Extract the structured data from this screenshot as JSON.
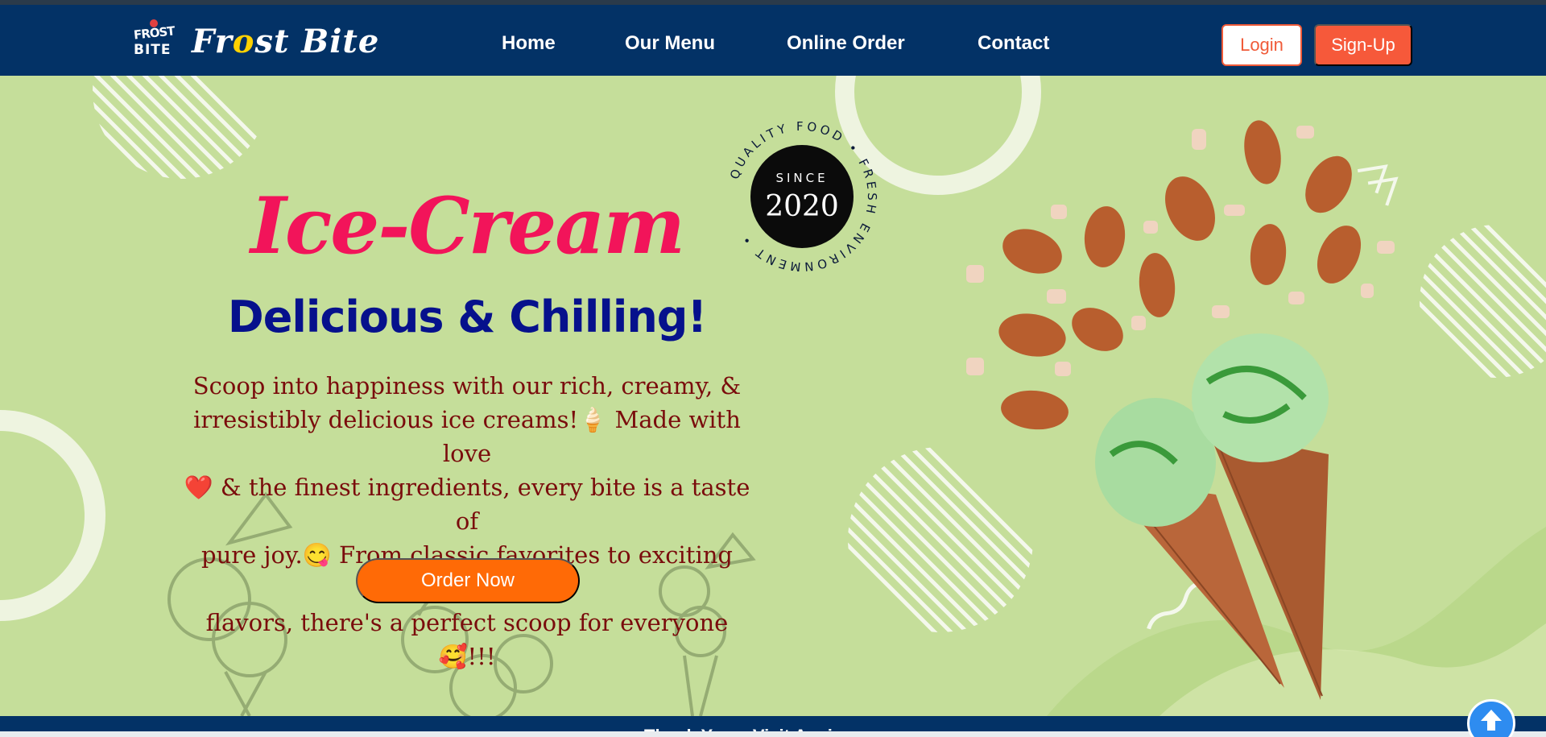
{
  "brand": {
    "badge_line1": "FROST",
    "badge_line2": "BITE",
    "name_part1": "Fr",
    "name_o": "o",
    "name_part2": "st Bite"
  },
  "nav": {
    "links": [
      "Home",
      "Our Menu",
      "Online Order",
      "Contact"
    ],
    "login_label": "Login",
    "signup_label": "Sign-Up"
  },
  "hero": {
    "title": "Ice-Cream",
    "subtitle": "Delicious & Chilling!",
    "description_lines": [
      "Scoop into happiness with our rich, creamy, &",
      "irresistibly delicious ice creams!🍦 Made with love",
      "❤️ & the finest ingredients, every bite is a taste of",
      "pure joy.😋 From classic favorites to exciting new",
      "flavors, there's a perfect scoop for everyone🥰!!!"
    ],
    "order_button": "Order Now"
  },
  "stamp": {
    "ring_text": "QUALITY FOOD • FRESH ENVIRONMENT •",
    "since": "SINCE",
    "year": "2020"
  },
  "footer": {
    "partial_text": "Thank You... Visit Again"
  },
  "colors": {
    "nav_bg": "#033266",
    "hero_bg": "#c5de9a",
    "title": "#f2145a",
    "subtitle": "#06118c",
    "desc": "#7a0c0c",
    "order_btn": "#ff6a06",
    "signup_btn": "#f6593a"
  }
}
